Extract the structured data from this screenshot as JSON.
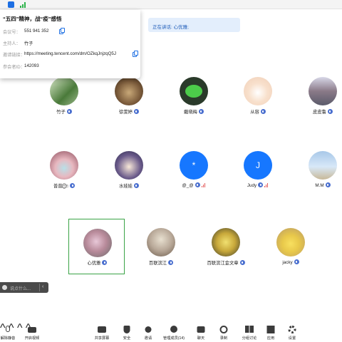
{
  "info_popup": {
    "title": "“五四”精神，战“疫”感悟",
    "meeting_id_label": "会议号：",
    "meeting_id": "551 941 352",
    "host_label": "主持人：",
    "host": "竹子",
    "invite_label": "邀请链接：",
    "invite_link": "https://meeting.tencent.com/dm/OZkqJnjzqQ5J",
    "participant_id_label": "参会者ID：",
    "participant_id": "142093"
  },
  "speaking": {
    "label": "正在讲话: 心优雅;"
  },
  "participants": [
    {
      "name": "竹子",
      "avatar": "photo-green-scene",
      "color": "#6a8a5a"
    },
    {
      "name": "徐雯婷",
      "avatar": "photo-cat",
      "color": "#8a6a4a"
    },
    {
      "name": "戴晓梅",
      "avatar": "wechat-logo",
      "color": "#3cb44a"
    },
    {
      "name": "从容",
      "avatar": "cartoon-bear",
      "color": "#f2d6c2"
    },
    {
      "name": "皮皮鲁",
      "avatar": "photo-street",
      "color": "#8a9ab8"
    },
    {
      "name": "普普ෆ͙̈⃝ෆ",
      "avatar": "anime-girl-mask",
      "color": "#d49aa8"
    },
    {
      "name": "水娃娃",
      "avatar": "anime-girl",
      "color": "#6a5a8a"
    },
    {
      "name": "@_@",
      "avatar_initial": "*",
      "color": "#1677ff"
    },
    {
      "name": "Judy",
      "avatar_initial": "J",
      "color": "#1677ff"
    },
    {
      "name": "M.M",
      "avatar": "photo-sky",
      "color": "#8ab0d8"
    },
    {
      "name": "心优雅",
      "avatar": "photo-flowers",
      "color": "#b88a9a"
    },
    {
      "name": "百联滨江",
      "avatar": "photo-city",
      "color": "#b8aa98"
    },
    {
      "name": "百联滨江金文章",
      "avatar": "photo-face",
      "color": "#c8a83a"
    },
    {
      "name": "jacky",
      "avatar": "pikachu",
      "color": "#e8c84a"
    }
  ],
  "chat": {
    "placeholder": "说点什么..."
  },
  "toolbar": {
    "mute": "解除静音",
    "video": "开启视频",
    "share": "共享屏幕",
    "security": "安全",
    "invite": "邀请",
    "manage": "管理成员(14)",
    "chat": "聊天",
    "record": "录制",
    "breakout": "分组讨论",
    "apps": "应用",
    "settings": "设置"
  },
  "colors": {
    "accent": "#1677ff",
    "active_border": "#3aa346",
    "banner_bg": "#e3eefc"
  }
}
